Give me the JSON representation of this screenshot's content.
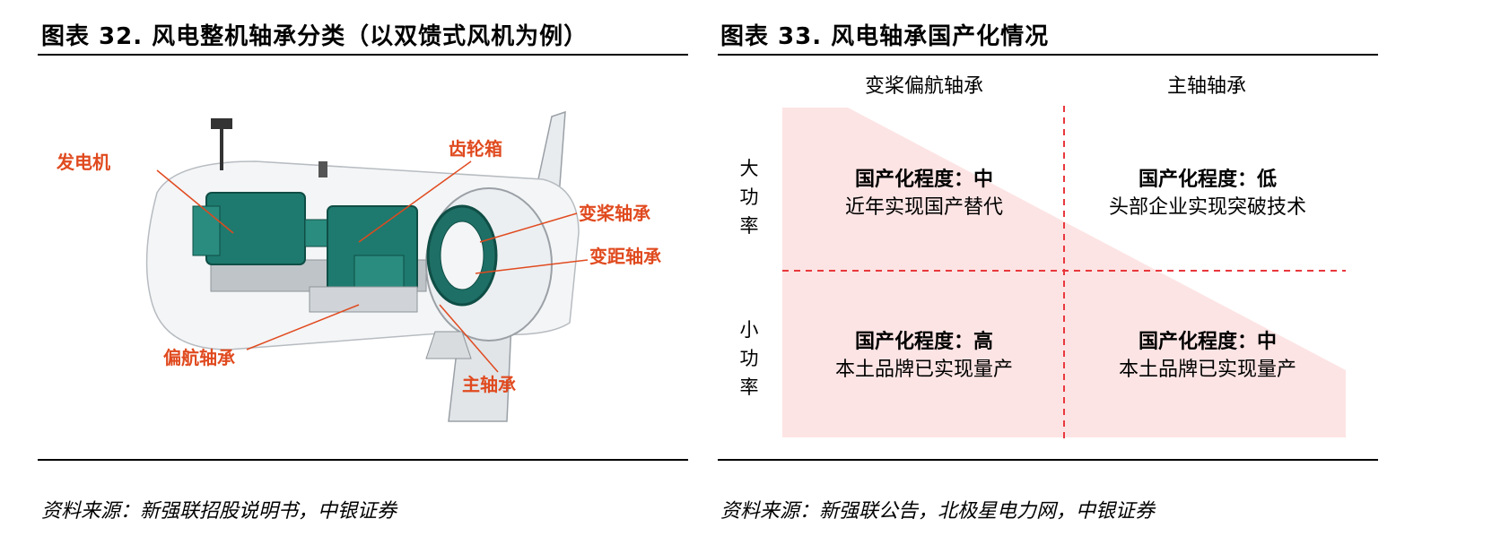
{
  "left_figure": {
    "title": "图表 32. 风电整机轴承分类（以双馈式风机为例）",
    "labels": {
      "generator": "发电机",
      "gearbox": "齿轮箱",
      "pitch_bearing_1": "变桨轴承",
      "pitch_bearing_2": "变距轴承",
      "yaw_bearing": "偏航轴承",
      "main_bearing": "主轴承"
    },
    "source": "资料来源：新强联招股说明书，中银证券"
  },
  "right_figure": {
    "title": "图表 33. 风电轴承国产化情况",
    "columns": [
      "变桨偏航轴承",
      "主轴轴承"
    ],
    "rows": [
      "大\n功\n率",
      "小\n功\n率"
    ],
    "cells": [
      [
        {
          "degree": "国产化程度：中",
          "desc": "近年实现国产替代"
        },
        {
          "degree": "国产化程度：低",
          "desc": "头部企业实现突破技术"
        }
      ],
      [
        {
          "degree": "国产化程度：高",
          "desc": "本土品牌已实现量产"
        },
        {
          "degree": "国产化程度：中",
          "desc": "本土品牌已实现量产"
        }
      ]
    ],
    "source": "资料来源：新强联公告，北极星电力网，中银证券"
  },
  "colors": {
    "callout": "#e04a1f",
    "triangle": "#fde4e4",
    "divider": "#e8383d",
    "machine": "#1e7a6e"
  }
}
